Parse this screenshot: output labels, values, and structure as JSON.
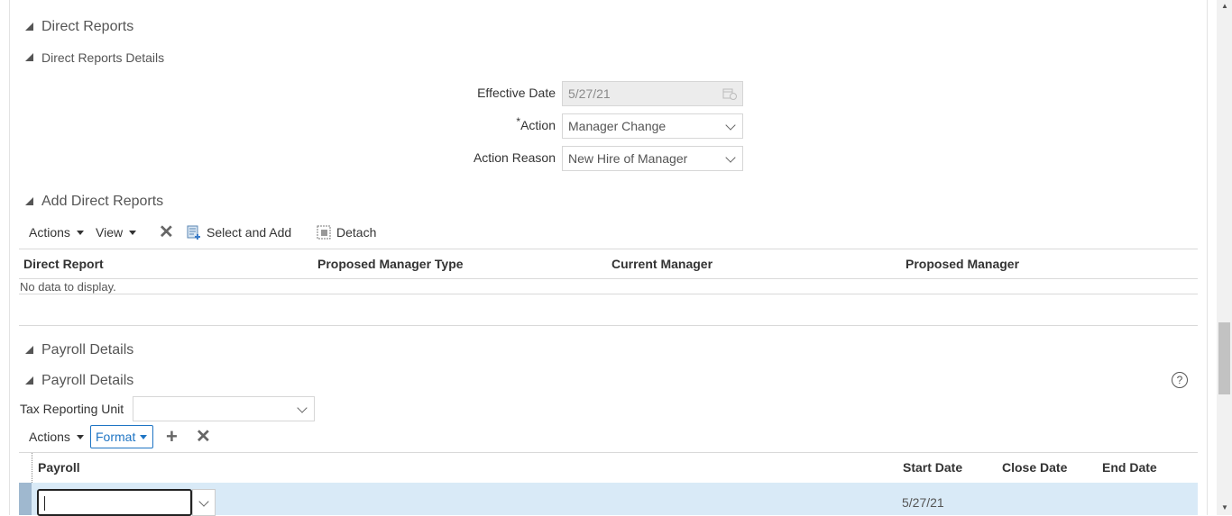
{
  "sections": {
    "direct_reports": "Direct Reports",
    "direct_reports_details": "Direct Reports Details",
    "add_direct_reports": "Add Direct Reports",
    "payroll_details_outer": "Payroll Details",
    "payroll_details_inner": "Payroll Details"
  },
  "form": {
    "effective_date_label": "Effective Date",
    "effective_date_value": "5/27/21",
    "action_required_mark": "*",
    "action_label": "Action",
    "action_value": "Manager Change",
    "action_reason_label": "Action Reason",
    "action_reason_value": "New Hire of Manager"
  },
  "direct_reports_toolbar": {
    "actions": "Actions",
    "view": "View",
    "select_and_add": "Select and Add",
    "detach": "Detach"
  },
  "direct_reports_table": {
    "columns": [
      "Direct Report",
      "Proposed Manager Type",
      "Current Manager",
      "Proposed Manager"
    ],
    "empty_text": "No data to display."
  },
  "payroll": {
    "tax_reporting_unit_label": "Tax Reporting Unit",
    "tax_reporting_unit_value": "",
    "help_glyph": "?",
    "toolbar": {
      "actions": "Actions",
      "format": "Format"
    },
    "columns": [
      "Payroll",
      "Start Date",
      "Close Date",
      "End Date"
    ],
    "rows": [
      {
        "payroll": "",
        "start_date": "5/27/21",
        "close_date": "",
        "end_date": ""
      }
    ]
  }
}
